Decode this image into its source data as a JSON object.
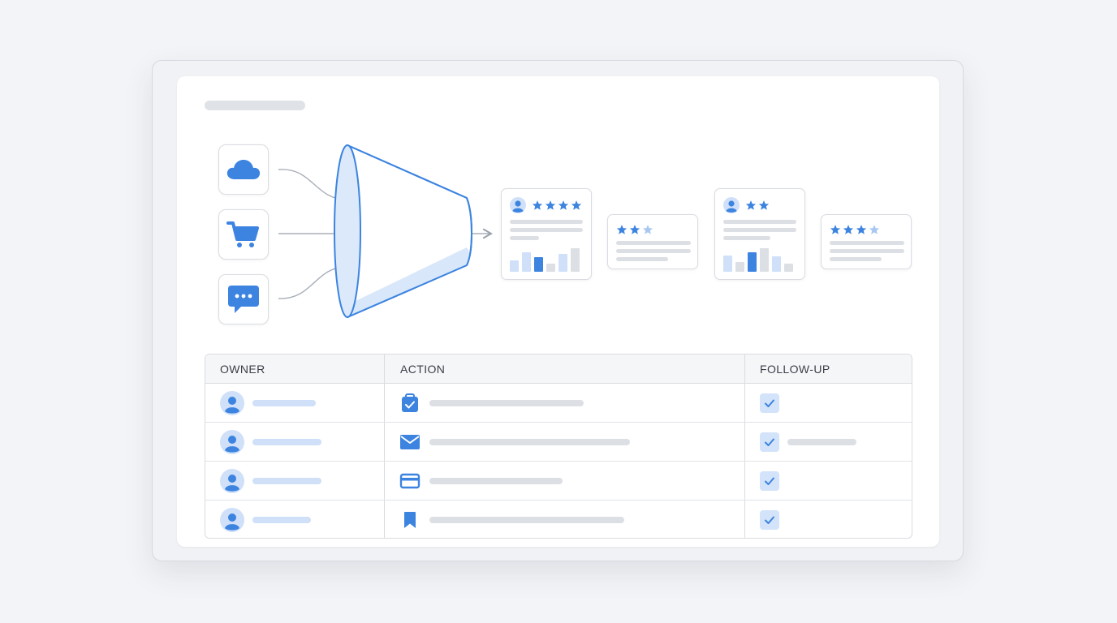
{
  "colors": {
    "accent": "#3c84e0",
    "accent_light": "#cfe0f8",
    "skeleton": "#dcdfe4",
    "border": "#d9dce2"
  },
  "sources": [
    {
      "icon": "cloud-icon"
    },
    {
      "icon": "shopping-cart-icon"
    },
    {
      "icon": "chat-bubble-icon"
    }
  ],
  "outputs": [
    {
      "has_avatar": true,
      "stars_full": 4,
      "stars_light": 0,
      "has_bars": true
    },
    {
      "has_avatar": false,
      "stars_full": 2,
      "stars_light": 1,
      "has_bars": false
    },
    {
      "has_avatar": true,
      "stars_full": 2,
      "stars_light": 0,
      "has_bars": true
    },
    {
      "has_avatar": false,
      "stars_full": 3,
      "stars_light": 1,
      "has_bars": false
    }
  ],
  "table": {
    "headers": {
      "owner": "OWNER",
      "action": "ACTION",
      "follow_up": "FOLLOW-UP"
    },
    "rows": [
      {
        "action_icon": "clipboard-check-icon",
        "follow_up_checked": true
      },
      {
        "action_icon": "envelope-icon",
        "follow_up_checked": true
      },
      {
        "action_icon": "credit-card-icon",
        "follow_up_checked": true
      },
      {
        "action_icon": "bookmark-icon",
        "follow_up_checked": true
      }
    ]
  }
}
